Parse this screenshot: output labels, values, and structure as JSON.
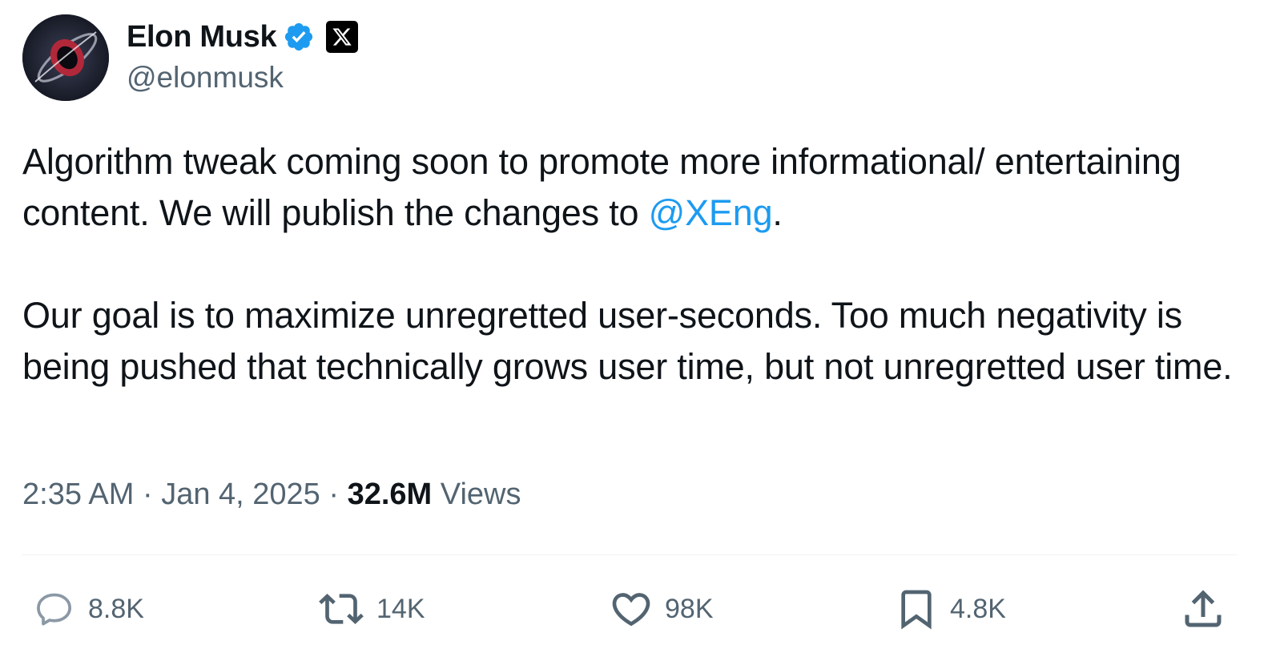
{
  "author": {
    "display_name": "Elon Musk",
    "handle": "@elonmusk",
    "verified_icon": "verified-badge-icon",
    "affiliation_icon": "x-logo-icon"
  },
  "post": {
    "line1_text": "Algorithm tweak coming soon to promote more informational/ entertaining content. We will publish the changes to ",
    "mention": "@XEng",
    "line1_end": ".",
    "paragraph2": "Our goal is to maximize unregretted user-seconds. Too much negativity is being pushed that technically grows user time, but not unregretted user time."
  },
  "meta": {
    "time": "2:35 AM",
    "separator": "·",
    "date": "Jan 4, 2025",
    "views_count": "32.6M",
    "views_label": "Views"
  },
  "actions": {
    "replies": "8.8K",
    "reposts": "14K",
    "likes": "98K",
    "bookmarks": "4.8K"
  },
  "colors": {
    "accent": "#1d9bf0",
    "text": "#0f1419",
    "secondary": "#536471"
  }
}
